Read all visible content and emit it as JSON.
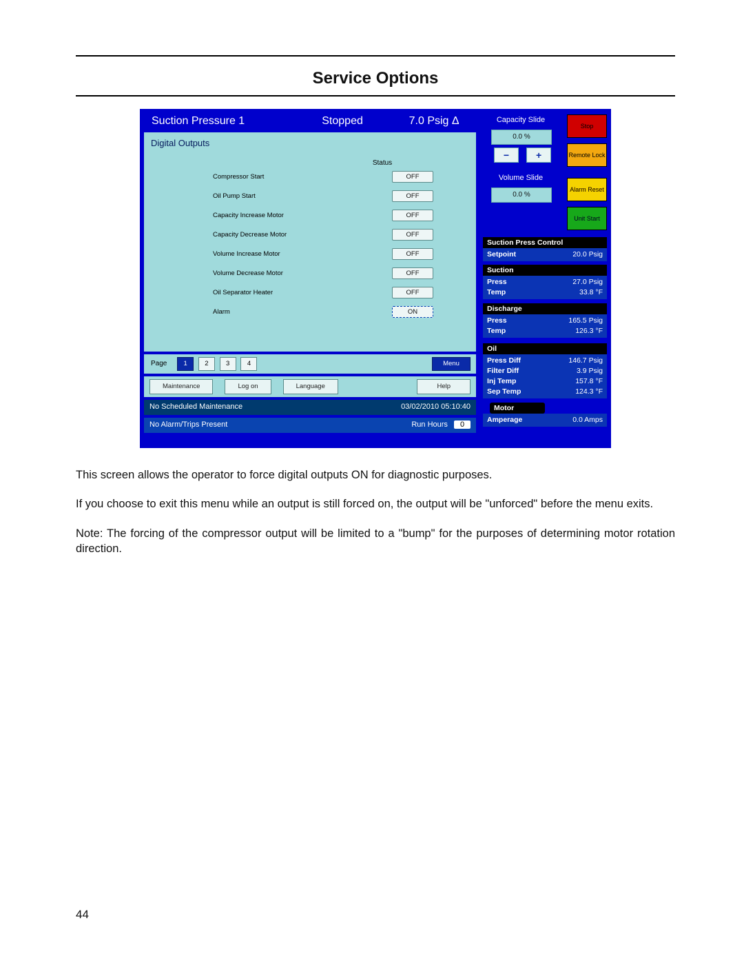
{
  "page": {
    "title": "Service Options",
    "number": "44"
  },
  "topbar": {
    "left": "Suction Pressure 1",
    "mid": "Stopped",
    "right": "7.0 Psig Δ"
  },
  "panel": {
    "title": "Digital Outputs",
    "status_header": "Status",
    "outputs": [
      {
        "label": "Compressor Start",
        "state": "OFF"
      },
      {
        "label": "Oil Pump Start",
        "state": "OFF"
      },
      {
        "label": "Capacity Increase Motor",
        "state": "OFF"
      },
      {
        "label": "Capacity Decrease Motor",
        "state": "OFF"
      },
      {
        "label": "Volume Increase Motor",
        "state": "OFF"
      },
      {
        "label": "Volume Decrease Motor",
        "state": "OFF"
      },
      {
        "label": "Oil Separator Heater",
        "state": "OFF"
      },
      {
        "label": "Alarm",
        "state": "ON"
      }
    ]
  },
  "pager": {
    "label": "Page",
    "pages": [
      "1",
      "2",
      "3",
      "4"
    ],
    "active": 0,
    "menu": "Menu"
  },
  "toolbar": {
    "buttons": [
      "Maintenance",
      "Log on",
      "Language",
      "Help"
    ]
  },
  "footer": {
    "maint": "No Scheduled Maintenance",
    "datetime": "03/02/2010  05:10:40",
    "alarm": "No Alarm/Trips Present",
    "runhours_label": "Run Hours",
    "runhours_value": "0"
  },
  "right": {
    "capacity_title": "Capacity Slide",
    "capacity_value": "0.0 %",
    "volume_title": "Volume Slide",
    "volume_value": "0.0 %",
    "cmd_stop": "Stop",
    "cmd_remote": "Remote Lock",
    "cmd_alarm": "Alarm Reset",
    "cmd_start": "Unit Start",
    "spc_head": "Suction Press Control",
    "spc": [
      [
        "Setpoint",
        "20.0 Psig"
      ]
    ],
    "suction_head": "Suction",
    "suction": [
      [
        "Press",
        "27.0 Psig"
      ],
      [
        "Temp",
        "33.8 °F"
      ]
    ],
    "discharge_head": "Discharge",
    "discharge": [
      [
        "Press",
        "165.5 Psig"
      ],
      [
        "Temp",
        "126.3 °F"
      ]
    ],
    "oil_head": "Oil",
    "oil": [
      [
        "Press Diff",
        "146.7 Psig"
      ],
      [
        "Filter Diff",
        "3.9 Psig"
      ],
      [
        "Inj Temp",
        "157.8 °F"
      ],
      [
        "Sep Temp",
        "124.3 °F"
      ]
    ],
    "motor_head": "Motor",
    "motor": [
      [
        "Amperage",
        "0.0 Amps"
      ]
    ]
  },
  "body": {
    "p1": "This screen allows the operator to force digital outputs ON for diagnostic purposes.",
    "p2": "If you choose to exit this menu while an output is still forced on, the output will be \"unforced\" before the menu exits.",
    "p3": "Note: The forcing of the compressor output will be limited to a \"bump\" for the purposes of determining motor rotation direction."
  }
}
